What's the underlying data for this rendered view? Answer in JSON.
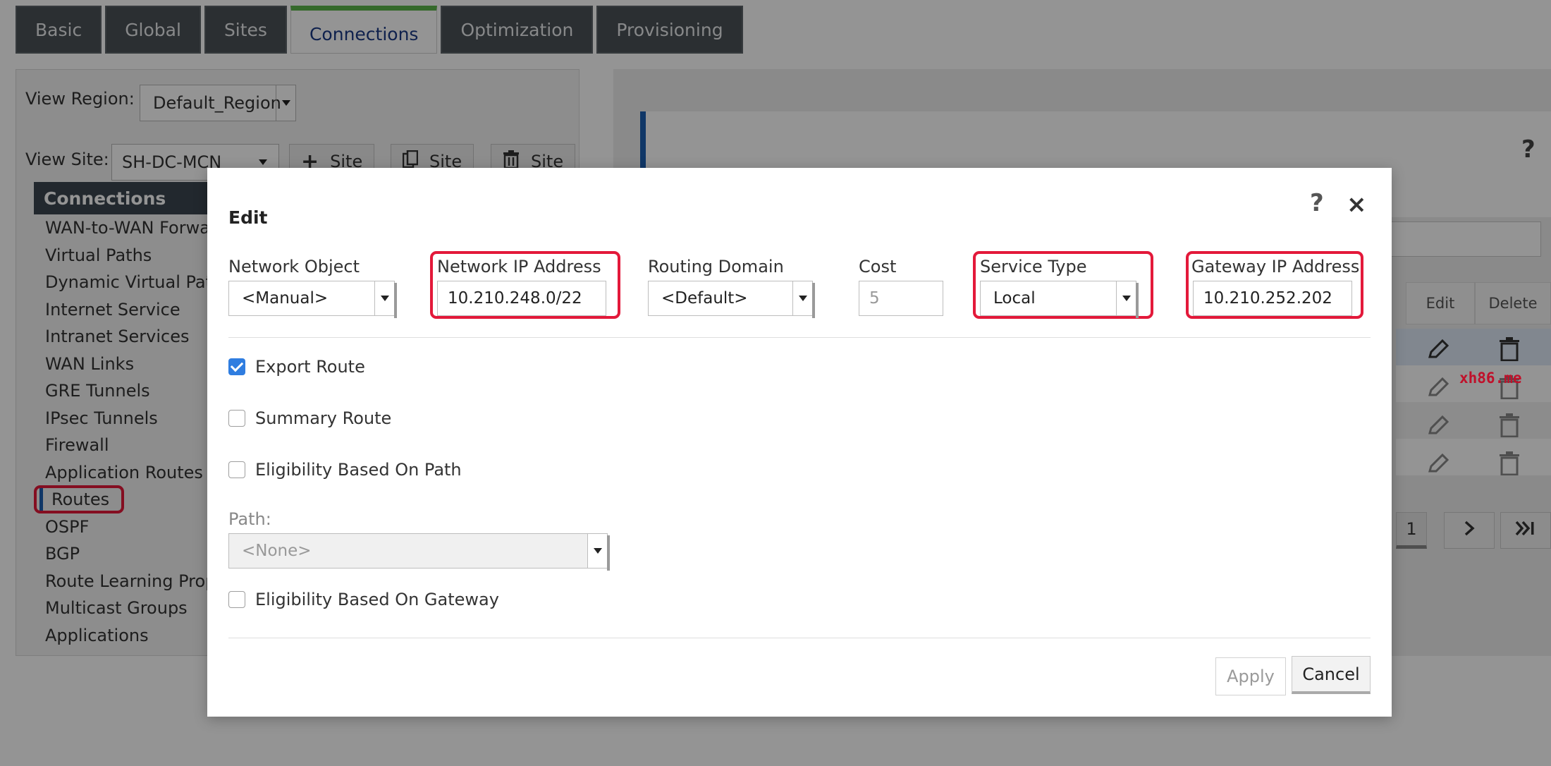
{
  "tabs": [
    "Basic",
    "Global",
    "Sites",
    "Connections",
    "Optimization",
    "Provisioning"
  ],
  "left_panel": {
    "view_region_label": "View Region:",
    "view_region_value": "Default_Region",
    "view_site_label": "View Site:",
    "view_site_value": "SH-DC-MCN",
    "site_buttons": [
      "Site",
      "Site",
      "Site"
    ],
    "connections_header": "Connections",
    "nav_items": [
      "WAN-to-WAN Forwa",
      "Virtual Paths",
      "Dynamic Virtual Path",
      "Internet Service",
      "Intranet Services",
      "WAN Links",
      "GRE Tunnels",
      "IPsec Tunnels",
      "Firewall",
      "Application Routes",
      "Routes",
      "OSPF",
      "BGP",
      "Route Learning Prop",
      "Multicast Groups",
      "Applications"
    ]
  },
  "right_panel": {
    "help": "?",
    "edit_header": "Edit",
    "delete_header": "Delete",
    "page_number": "1"
  },
  "watermark": "xh86.me",
  "modal": {
    "title": "Edit",
    "help": "?",
    "close": "×",
    "network_object": {
      "label": "Network Object",
      "value": "<Manual>"
    },
    "network_ip": {
      "label": "Network IP Address",
      "value": "10.210.248.0/22"
    },
    "routing_domain": {
      "label": "Routing Domain",
      "value": "<Default>"
    },
    "cost": {
      "label": "Cost",
      "value": "5"
    },
    "service_type": {
      "label": "Service Type",
      "value": "Local"
    },
    "gateway_ip": {
      "label": "Gateway IP Address",
      "value": "10.210.252.202"
    },
    "export_route": {
      "label": "Export Route",
      "checked": true
    },
    "summary_route": {
      "label": "Summary Route",
      "checked": false
    },
    "eligibility_path": {
      "label": "Eligibility Based On Path",
      "checked": false
    },
    "path": {
      "label": "Path:",
      "value": "<None>"
    },
    "eligibility_gateway": {
      "label": "Eligibility Based On Gateway",
      "checked": false
    },
    "apply_label": "Apply",
    "cancel_label": "Cancel"
  },
  "colors": {
    "highlight": "#e3193a",
    "accent_blue": "#1c5fb2",
    "checkbox_blue": "#2f7de0"
  }
}
